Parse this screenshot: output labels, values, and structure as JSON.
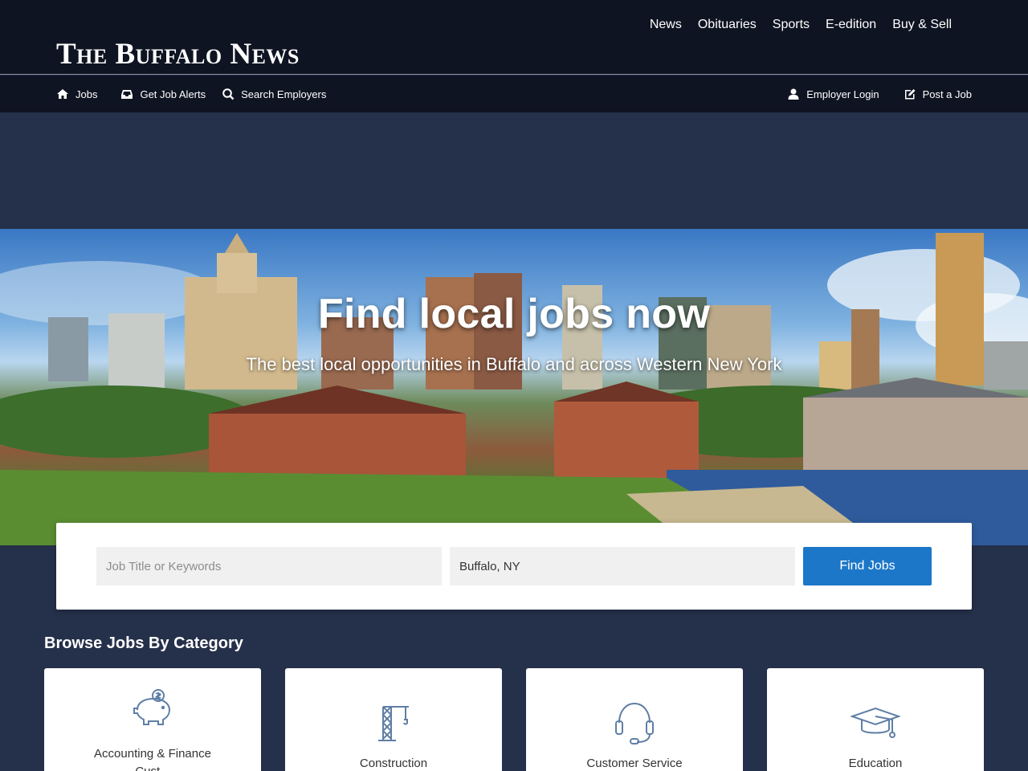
{
  "header": {
    "logo": "The Buffalo News",
    "top_nav": [
      "News",
      "Obituaries",
      "Sports",
      "E-edition",
      "Buy & Sell"
    ]
  },
  "subnav": {
    "jobs": "Jobs",
    "alerts": "Get Job Alerts",
    "employers": "Search Employers",
    "employer_login": "Employer Login",
    "post_job": "Post a Job"
  },
  "hero": {
    "title": "Find local jobs now",
    "subtitle": "The best local opportunities in Buffalo and across Western New York"
  },
  "search": {
    "keywords_placeholder": "Job Title or Keywords",
    "location_value": "Buffalo, NY",
    "button_label": "Find Jobs"
  },
  "categories": {
    "heading": "Browse Jobs By Category",
    "items": [
      {
        "label": "Accounting & Finance",
        "label_line2": "Cust...",
        "icon": "piggy-bank-icon"
      },
      {
        "label": "Construction",
        "icon": "crane-icon"
      },
      {
        "label": "Customer Service",
        "icon": "headset-icon"
      },
      {
        "label": "Education",
        "icon": "graduation-cap-icon"
      }
    ]
  }
}
